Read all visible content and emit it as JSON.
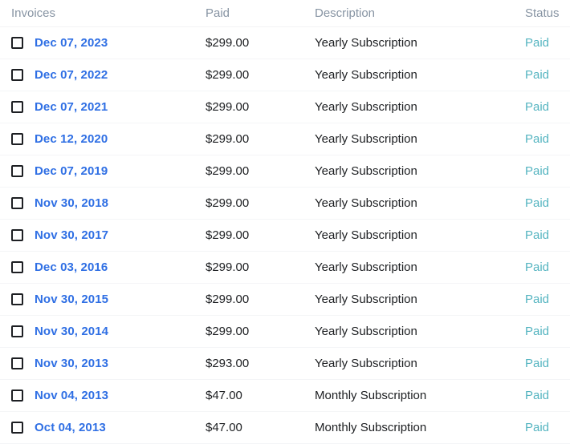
{
  "table": {
    "columns": [
      {
        "key": "invoice",
        "label": "Invoices"
      },
      {
        "key": "paid",
        "label": "Paid"
      },
      {
        "key": "description",
        "label": "Description"
      },
      {
        "key": "status",
        "label": "Status"
      }
    ],
    "colors": {
      "header_text": "#8794a3",
      "link_blue": "#2f6fe4",
      "status_teal": "#54b4c0",
      "body_text": "#1c1e21",
      "row_divider": "#f4f5f7",
      "background": "#ffffff",
      "checkbox_border": "#1d1f23"
    },
    "checkbox_icon": "checkbox-unchecked-icon",
    "rows": [
      {
        "date": "Dec 07, 2023",
        "amount": "$299.00",
        "description": "Yearly Subscription",
        "status": "Paid",
        "checked": false
      },
      {
        "date": "Dec 07, 2022",
        "amount": "$299.00",
        "description": "Yearly Subscription",
        "status": "Paid",
        "checked": false
      },
      {
        "date": "Dec 07, 2021",
        "amount": "$299.00",
        "description": "Yearly Subscription",
        "status": "Paid",
        "checked": false
      },
      {
        "date": "Dec 12, 2020",
        "amount": "$299.00",
        "description": "Yearly Subscription",
        "status": "Paid",
        "checked": false
      },
      {
        "date": "Dec 07, 2019",
        "amount": "$299.00",
        "description": "Yearly Subscription",
        "status": "Paid",
        "checked": false
      },
      {
        "date": "Nov 30, 2018",
        "amount": "$299.00",
        "description": "Yearly Subscription",
        "status": "Paid",
        "checked": false
      },
      {
        "date": "Nov 30, 2017",
        "amount": "$299.00",
        "description": "Yearly Subscription",
        "status": "Paid",
        "checked": false
      },
      {
        "date": "Dec 03, 2016",
        "amount": "$299.00",
        "description": "Yearly Subscription",
        "status": "Paid",
        "checked": false
      },
      {
        "date": "Nov 30, 2015",
        "amount": "$299.00",
        "description": "Yearly Subscription",
        "status": "Paid",
        "checked": false
      },
      {
        "date": "Nov 30, 2014",
        "amount": "$299.00",
        "description": "Yearly Subscription",
        "status": "Paid",
        "checked": false
      },
      {
        "date": "Nov 30, 2013",
        "amount": "$293.00",
        "description": "Yearly Subscription",
        "status": "Paid",
        "checked": false
      },
      {
        "date": "Nov 04, 2013",
        "amount": "$47.00",
        "description": "Monthly Subscription",
        "status": "Paid",
        "checked": false
      },
      {
        "date": "Oct 04, 2013",
        "amount": "$47.00",
        "description": "Monthly Subscription",
        "status": "Paid",
        "checked": false
      }
    ]
  }
}
